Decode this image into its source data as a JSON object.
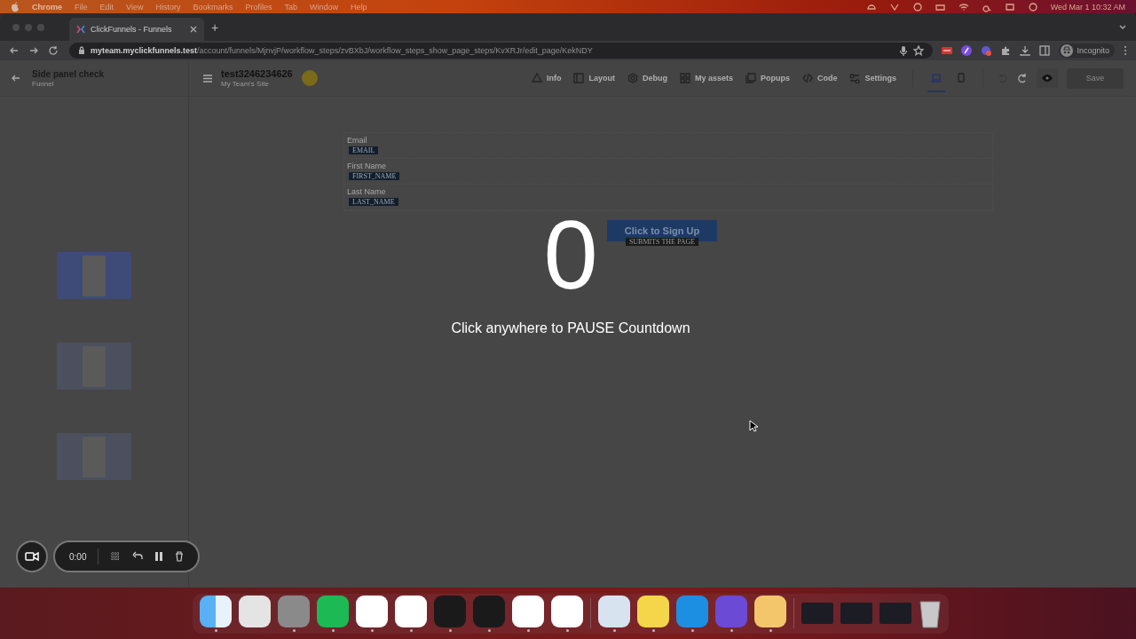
{
  "menu_bar": {
    "app": "Chrome",
    "items": [
      "File",
      "Edit",
      "View",
      "History",
      "Bookmarks",
      "Profiles",
      "Tab",
      "Window",
      "Help"
    ],
    "clock": "Wed Mar 1  10:32 AM"
  },
  "browser": {
    "tabs": [
      {
        "label": "ClickFunnels - Funnels",
        "selected": true
      }
    ],
    "new_tab": "+",
    "url": "**myteam.myclickfunnels.test**/account/funnels/MjnvjP/workflow_steps/zvBXbJ/workflow_steps_show_page_steps/KvXRJr/edit_page/KekNDY",
    "profile": "Incognito"
  },
  "editor_header": {
    "funnel_title": "Side panel check",
    "funnel_subtitle": "Funnel",
    "page_title": "test3246234626",
    "site_name": "My Team's Site",
    "toolbar": [
      {
        "label": "Info"
      },
      {
        "label": "Layout"
      },
      {
        "label": "Debug"
      },
      {
        "label": "My assets"
      },
      {
        "label": "Popups"
      },
      {
        "label": "Code"
      },
      {
        "label": "Settings"
      }
    ],
    "devices": [
      {
        "selected": true
      },
      {
        "selected": false
      }
    ],
    "save": {
      "label": "Save",
      "disabled": true
    }
  },
  "sidebar": {
    "pages": [
      {
        "selected": true
      },
      {
        "selected": false
      },
      {
        "selected": false
      }
    ]
  },
  "form": {
    "fields": [
      {
        "label": "Email",
        "tag": "EMAIL"
      },
      {
        "label": "First Name",
        "tag": "FIRST_NAME"
      },
      {
        "label": "Last Name",
        "tag": "LAST_NAME"
      }
    ],
    "button": {
      "label": "Click to Sign Up",
      "tag": "SUBMITS THE PAGE"
    }
  },
  "countdown": {
    "number": "0",
    "message": "Click anywhere to PAUSE Countdown"
  },
  "recorder": {
    "time": "0:00"
  },
  "dock": [
    {
      "running": true
    },
    {
      "running": false
    },
    {
      "running": true
    },
    {
      "running": true
    },
    {
      "running": true
    },
    {
      "running": true
    },
    {
      "running": true
    },
    {
      "running": true
    },
    {
      "running": true
    },
    {
      "running": true
    },
    {
      "running": true
    },
    {
      "running": true
    },
    {
      "running": true
    },
    {
      "running": true
    },
    {
      "running": true
    }
  ]
}
